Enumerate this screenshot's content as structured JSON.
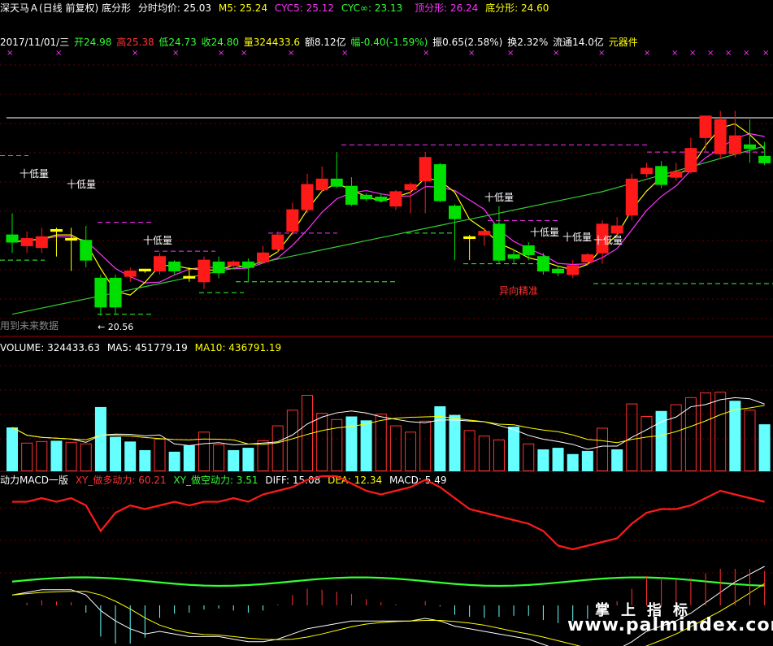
{
  "header": {
    "stock_name": "深天马Ａ(日线 前复权) 底分形",
    "avg_price": "分时均价: 25.03",
    "m5": "M5: 25.24",
    "cyc5": "CYC5: 25.12",
    "cycinf": "CYC∞: 23.13",
    "top_fractal": "顶分形: 26.24",
    "bottom_fractal": "底分形: 24.60",
    "colors": {
      "white": "#ffffff",
      "yellow": "#ffff00",
      "magenta": "#ff33ff",
      "red": "#ff3333"
    }
  },
  "quote": {
    "date": "2017/11/01/三",
    "open": "开24.98",
    "high": "高25.38",
    "low": "低24.73",
    "close": "收24.80",
    "volume": "量324433.6",
    "amount": "额8.12亿",
    "change": "幅-0.40(-1.59%)",
    "amplitude": "振0.65(2.58%)",
    "turnover": "换2.32%",
    "float": "流通14.0亿",
    "sector": "元器件"
  },
  "annotations": {
    "low_tag": "十低量",
    "signal": "异向精准",
    "min_price": "20.56",
    "future_note": "用到未来数据"
  },
  "volume_header": {
    "volume": "VOLUME: 324433.63",
    "ma5": "MA5: 451779.19",
    "ma10": "MA10: 436791.19"
  },
  "macd_header": {
    "name": "动力MACD一版",
    "bull": "XY_做多动力: 60.21",
    "bear": "XY_做空动力: 3.51",
    "diff": "DIFF: 15.08",
    "dea": "DEA: 12.34",
    "macd": "MACD: 5.49"
  },
  "watermark": {
    "cn": "掌上指标",
    "url": "www.palmindex.com"
  },
  "chart_data": {
    "type": "candlestick",
    "price_range": [
      20.3,
      26.5
    ],
    "candles": [
      {
        "o": 22.8,
        "c": 22.6,
        "h": 23.4,
        "l": 22.3
      },
      {
        "o": 22.5,
        "c": 22.7,
        "h": 22.9,
        "l": 22.3
      },
      {
        "o": 22.45,
        "c": 22.75,
        "h": 23.0,
        "l": 22.3
      },
      {
        "o": 22.9,
        "c": 22.95,
        "h": 23.0,
        "l": 22.2
      },
      {
        "o": 22.7,
        "c": 22.7,
        "h": 23.0,
        "l": 21.8
      },
      {
        "o": 22.65,
        "c": 22.1,
        "h": 23.05,
        "l": 21.9
      },
      {
        "o": 21.6,
        "c": 20.8,
        "h": 21.7,
        "l": 20.56
      },
      {
        "o": 21.6,
        "c": 20.8,
        "h": 21.7,
        "l": 20.6
      },
      {
        "o": 21.65,
        "c": 21.8,
        "h": 21.9,
        "l": 21.5
      },
      {
        "o": 21.8,
        "c": 21.85,
        "h": 21.85,
        "l": 21.75
      },
      {
        "o": 21.8,
        "c": 22.2,
        "h": 22.3,
        "l": 21.7
      },
      {
        "o": 22.05,
        "c": 21.8,
        "h": 22.1,
        "l": 21.7
      },
      {
        "o": 21.65,
        "c": 21.6,
        "h": 21.9,
        "l": 21.5
      },
      {
        "o": 21.5,
        "c": 22.1,
        "h": 22.2,
        "l": 21.3
      },
      {
        "o": 22.05,
        "c": 21.75,
        "h": 22.2,
        "l": 21.6
      },
      {
        "o": 21.95,
        "c": 22.05,
        "h": 22.1,
        "l": 21.9
      },
      {
        "o": 22.05,
        "c": 21.9,
        "h": 22.15,
        "l": 21.5
      },
      {
        "o": 22.05,
        "c": 22.3,
        "h": 22.5,
        "l": 22.0
      },
      {
        "o": 22.4,
        "c": 22.8,
        "h": 22.9,
        "l": 22.3
      },
      {
        "o": 22.9,
        "c": 23.5,
        "h": 23.7,
        "l": 22.8
      },
      {
        "o": 23.5,
        "c": 24.2,
        "h": 24.5,
        "l": 23.4
      },
      {
        "o": 24.05,
        "c": 24.35,
        "h": 24.7,
        "l": 24.0
      },
      {
        "o": 24.35,
        "c": 24.15,
        "h": 25.1,
        "l": 24.1
      },
      {
        "o": 24.15,
        "c": 23.65,
        "h": 24.4,
        "l": 23.6
      },
      {
        "o": 23.9,
        "c": 23.8,
        "h": 23.95,
        "l": 23.75
      },
      {
        "o": 23.85,
        "c": 23.75,
        "h": 23.95,
        "l": 23.7
      },
      {
        "o": 23.6,
        "c": 24.0,
        "h": 24.05,
        "l": 23.5
      },
      {
        "o": 24.05,
        "c": 24.2,
        "h": 24.25,
        "l": 23.4
      },
      {
        "o": 24.3,
        "c": 24.95,
        "h": 25.1,
        "l": 23.4
      },
      {
        "o": 24.75,
        "c": 23.75,
        "h": 24.8,
        "l": 23.7
      },
      {
        "o": 23.6,
        "c": 23.25,
        "h": 23.65,
        "l": 22.1
      },
      {
        "o": 22.75,
        "c": 22.7,
        "h": 22.8,
        "l": 22.1
      },
      {
        "o": 22.8,
        "c": 22.9,
        "h": 23.0,
        "l": 22.5
      },
      {
        "o": 23.1,
        "c": 22.1,
        "h": 23.6,
        "l": 22.0
      },
      {
        "o": 22.25,
        "c": 22.15,
        "h": 22.4,
        "l": 22.0
      },
      {
        "o": 22.5,
        "c": 22.25,
        "h": 22.6,
        "l": 22.1
      },
      {
        "o": 22.2,
        "c": 21.8,
        "h": 22.3,
        "l": 21.7
      },
      {
        "o": 21.85,
        "c": 21.75,
        "h": 21.95,
        "l": 21.65
      },
      {
        "o": 21.7,
        "c": 21.95,
        "h": 22.1,
        "l": 21.6
      },
      {
        "o": 22.05,
        "c": 22.25,
        "h": 22.3,
        "l": 21.95
      },
      {
        "o": 22.3,
        "c": 23.1,
        "h": 23.2,
        "l": 22.0
      },
      {
        "o": 22.85,
        "c": 23.05,
        "h": 23.3,
        "l": 22.8
      },
      {
        "o": 23.35,
        "c": 24.35,
        "h": 24.5,
        "l": 23.2
      },
      {
        "o": 24.5,
        "c": 24.65,
        "h": 24.8,
        "l": 24.4
      },
      {
        "o": 24.7,
        "c": 24.2,
        "h": 24.85,
        "l": 24.1
      },
      {
        "o": 24.4,
        "c": 24.55,
        "h": 24.8,
        "l": 24.3
      },
      {
        "o": 24.55,
        "c": 25.2,
        "h": 25.5,
        "l": 24.5
      },
      {
        "o": 25.5,
        "c": 26.1,
        "h": 26.1,
        "l": 25.1
      },
      {
        "o": 25.05,
        "c": 26.0,
        "h": 26.24,
        "l": 24.9
      },
      {
        "o": 25.05,
        "c": 25.55,
        "h": 26.24,
        "l": 24.95
      },
      {
        "o": 25.3,
        "c": 25.2,
        "h": 26.0,
        "l": 24.8
      },
      {
        "o": 24.98,
        "c": 24.8,
        "h": 25.38,
        "l": 24.73
      }
    ],
    "volume_range": [
      0,
      1400000
    ],
    "volume": [
      560000,
      360000,
      380000,
      390000,
      370000,
      350000,
      820000,
      440000,
      380000,
      270000,
      410000,
      250000,
      330000,
      500000,
      340000,
      270000,
      300000,
      390000,
      580000,
      780000,
      970000,
      740000,
      660000,
      700000,
      650000,
      730000,
      580000,
      500000,
      640000,
      830000,
      720000,
      520000,
      450000,
      400000,
      570000,
      350000,
      280000,
      300000,
      220000,
      260000,
      550000,
      280000,
      860000,
      700000,
      770000,
      850000,
      940000,
      1000000,
      1010000,
      900000,
      780000,
      600000
    ],
    "volume_colors": [
      "c",
      "r",
      "r",
      "c",
      "r",
      "r",
      "c",
      "c",
      "c",
      "c",
      "r",
      "c",
      "c",
      "r",
      "r",
      "c",
      "c",
      "r",
      "r",
      "r",
      "r",
      "r",
      "r",
      "c",
      "c",
      "r",
      "r",
      "r",
      "r",
      "c",
      "c",
      "r",
      "r",
      "r",
      "c",
      "r",
      "c",
      "c",
      "c",
      "c",
      "r",
      "c",
      "r",
      "r",
      "c",
      "r",
      "r",
      "r",
      "r",
      "c",
      "r",
      "c"
    ],
    "macd_bull": [
      60,
      60,
      61,
      60,
      61,
      59,
      52,
      57,
      59,
      58,
      59,
      60,
      59,
      60,
      60,
      61,
      60,
      62,
      63,
      64,
      66,
      67,
      67,
      65,
      63,
      62,
      63,
      64,
      66,
      64,
      61,
      58,
      57,
      56,
      55,
      54,
      52,
      48,
      47,
      48,
      49,
      50,
      54,
      57,
      58,
      58,
      59,
      61,
      63,
      62,
      61,
      60
    ],
    "macd_diff": [
      4,
      5,
      6,
      6,
      6,
      4,
      -2,
      -6,
      -9,
      -11,
      -10,
      -11,
      -12,
      -12,
      -12,
      -13,
      -14,
      -14,
      -13,
      -11,
      -9,
      -8,
      -7,
      -6,
      -6,
      -6,
      -6,
      -6,
      -5,
      -6,
      -8,
      -9,
      -10,
      -11,
      -12,
      -13,
      -15,
      -17,
      -18,
      -19,
      -18,
      -17,
      -14,
      -10,
      -8,
      -6,
      -3,
      1,
      5,
      9,
      12,
      15
    ],
    "series_names": [
      "VOLUME",
      "MA5",
      "MA10",
      "XY_做多动力",
      "XY_做空动力",
      "DIFF",
      "DEA",
      "MACD"
    ]
  }
}
